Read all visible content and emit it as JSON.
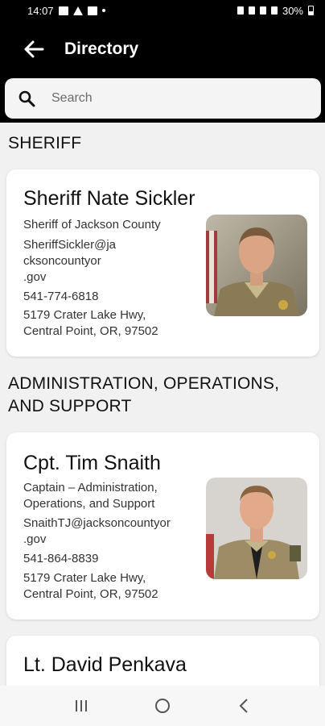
{
  "status_bar": {
    "time": "14:07",
    "battery": "30%"
  },
  "app_bar": {
    "title": "Directory"
  },
  "search": {
    "placeholder": "Search"
  },
  "sections": [
    {
      "header_lines": [
        "SHERIFF"
      ],
      "cards": [
        {
          "name": "Sheriff Nate Sickler",
          "title_lines": [
            "Sheriff of Jackson County"
          ],
          "email_lines": [
            "SheriffSickler@ja",
            "cksoncountyor",
            ".gov"
          ],
          "phone": "541-774-6818",
          "address_lines": [
            "5179 Crater Lake Hwy,",
            "Central Point, OR, 97502"
          ]
        }
      ]
    },
    {
      "header_lines": [
        "ADMINISTRATION, OPERATIONS,",
        "AND SUPPORT"
      ],
      "cards": [
        {
          "name": "Cpt. Tim Snaith",
          "title_lines": [
            "Captain – Administration,",
            "Operations, and Support"
          ],
          "email_lines": [
            "SnaithTJ@jacksoncountyor",
            ".gov"
          ],
          "phone": "541-864-8839",
          "address_lines": [
            "5179 Crater Lake Hwy,",
            "Central Point, OR, 97502"
          ]
        },
        {
          "name": "Lt. David Penkava"
        }
      ]
    }
  ],
  "icons": {
    "back": "arrow-left-icon",
    "search": "search-icon",
    "nav": [
      "recents-icon",
      "home-icon",
      "back-icon"
    ]
  },
  "colors": {
    "app_bar": "#000000",
    "background": "#f1f1f1",
    "card": "#ffffff"
  }
}
